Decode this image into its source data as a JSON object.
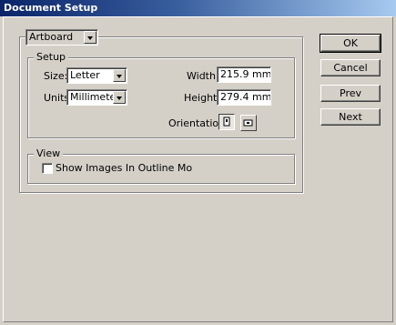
{
  "window": {
    "title": "Document Setup"
  },
  "preset": {
    "value": "Artboard"
  },
  "setup": {
    "legend": "Setup",
    "size_label": "Size:",
    "size_value": "Letter",
    "units_label": "Units",
    "units_value": "Millimeters",
    "width_label": "Width:",
    "width_value": "215.9 mm",
    "height_label": "Height",
    "height_value": "279.4 mm",
    "orientation_label": "Orientation"
  },
  "view": {
    "legend": "View",
    "show_images_label": "Show Images In Outline Mo",
    "show_images_checked": false
  },
  "buttons": {
    "ok": "OK",
    "cancel": "Cancel",
    "prev": "Prev",
    "next": "Next"
  },
  "icons": {
    "dropdown": "chevron-down-icon",
    "portrait": "portrait-orientation-icon",
    "landscape": "landscape-orientation-icon"
  }
}
